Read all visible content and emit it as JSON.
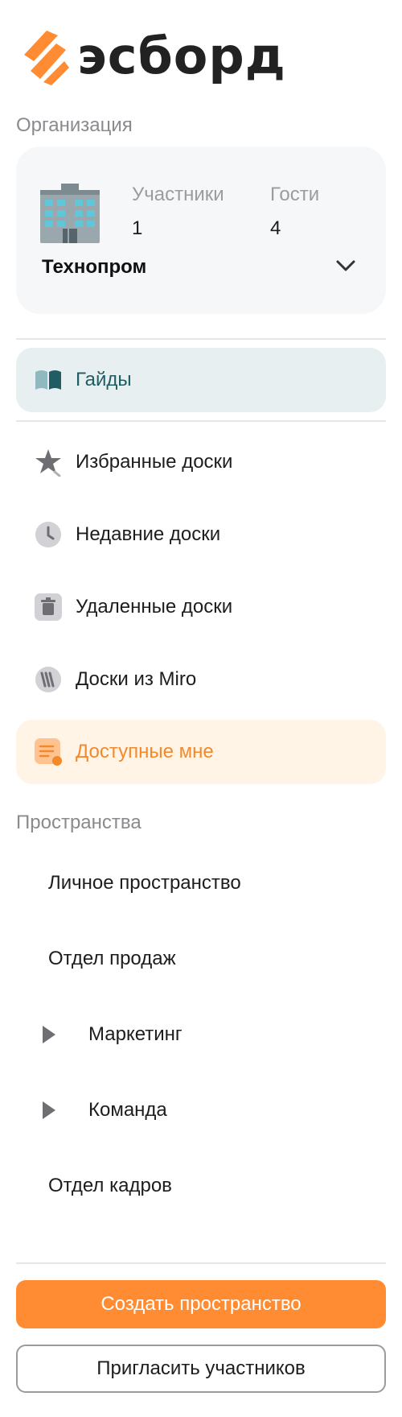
{
  "brand": {
    "name": "эсборд",
    "accent": "#ff8c33"
  },
  "organization": {
    "section_title": "Организация",
    "name": "Технопром",
    "members_label": "Участники",
    "members_count": "1",
    "guests_label": "Гости",
    "guests_count": "4",
    "icon": "building-icon"
  },
  "nav": [
    {
      "label": "Гайды",
      "icon": "book-icon"
    },
    {
      "label": "Избранные доски",
      "icon": "star-icon"
    },
    {
      "label": "Недавние доски",
      "icon": "clock-icon"
    },
    {
      "label": "Удаленные доски",
      "icon": "trash-icon"
    },
    {
      "label": "Доски из Miro",
      "icon": "miro-icon"
    },
    {
      "label": "Доступные мне",
      "icon": "shared-doc-icon"
    }
  ],
  "spaces": {
    "section_title": "Пространства",
    "items": [
      {
        "label": "Личное пространство"
      },
      {
        "label": "Отдел продаж"
      },
      {
        "label": "Маркетинг",
        "collapsible": true
      },
      {
        "label": "Команда",
        "collapsible": true
      },
      {
        "label": "Отдел кадров"
      }
    ]
  },
  "actions": {
    "create_space": "Создать пространство",
    "invite_members": "Пригласить участников"
  }
}
